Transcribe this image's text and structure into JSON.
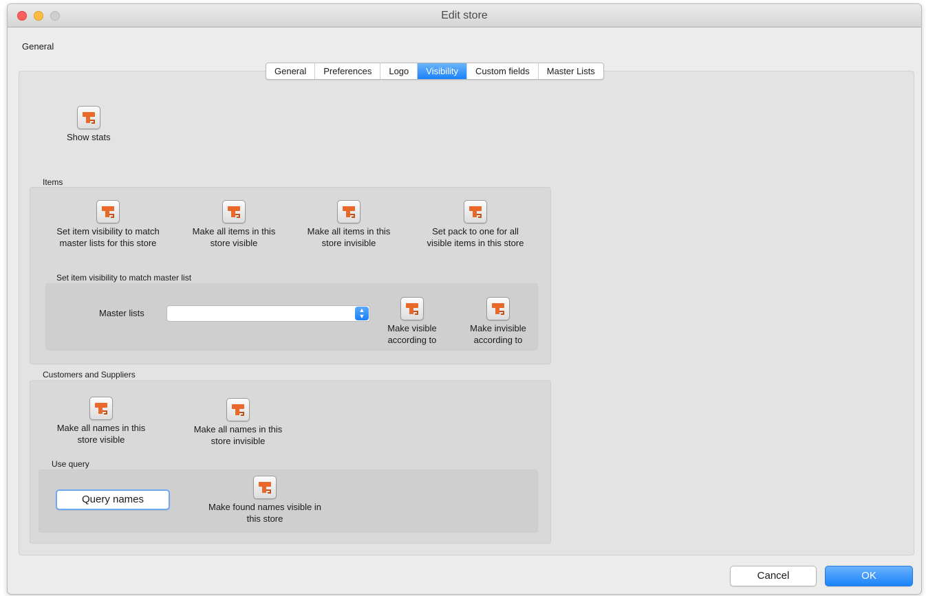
{
  "window": {
    "title": "Edit store"
  },
  "header": {
    "general_label": "General"
  },
  "tabs": [
    "General",
    "Preferences",
    "Logo",
    "Visibility",
    "Custom fields",
    "Master Lists"
  ],
  "active_tab": "Visibility",
  "show_stats": {
    "label": "Show stats"
  },
  "items_section": {
    "label": "Items",
    "buttons": [
      {
        "label": "Set item visibility to match\nmaster lists for this store"
      },
      {
        "label": "Make all items in this\nstore visible"
      },
      {
        "label": "Make all items in this\nstore invisible"
      },
      {
        "label": "Set pack to one for all\nvisible items in this store"
      }
    ],
    "master_list_group": {
      "label": "Set item visibility to match master list",
      "field_label": "Master lists",
      "selected_value": "",
      "buttons": [
        {
          "label": "Make visible\naccording to"
        },
        {
          "label": "Make invisible\naccording to"
        }
      ]
    }
  },
  "customers_section": {
    "label": "Customers and Suppliers",
    "buttons": [
      {
        "label": "Make all names in this\nstore visible"
      },
      {
        "label": "Make all names in this\nstore invisible"
      }
    ],
    "query_group": {
      "label": "Use query",
      "query_button": "Query names",
      "found_button": {
        "label": "Make found names visible in\nthis store"
      }
    }
  },
  "footer": {
    "cancel_label": "Cancel",
    "ok_label": "OK"
  },
  "colors": {
    "accent": "#1a82fb",
    "icon_orange": "#e8692a"
  }
}
